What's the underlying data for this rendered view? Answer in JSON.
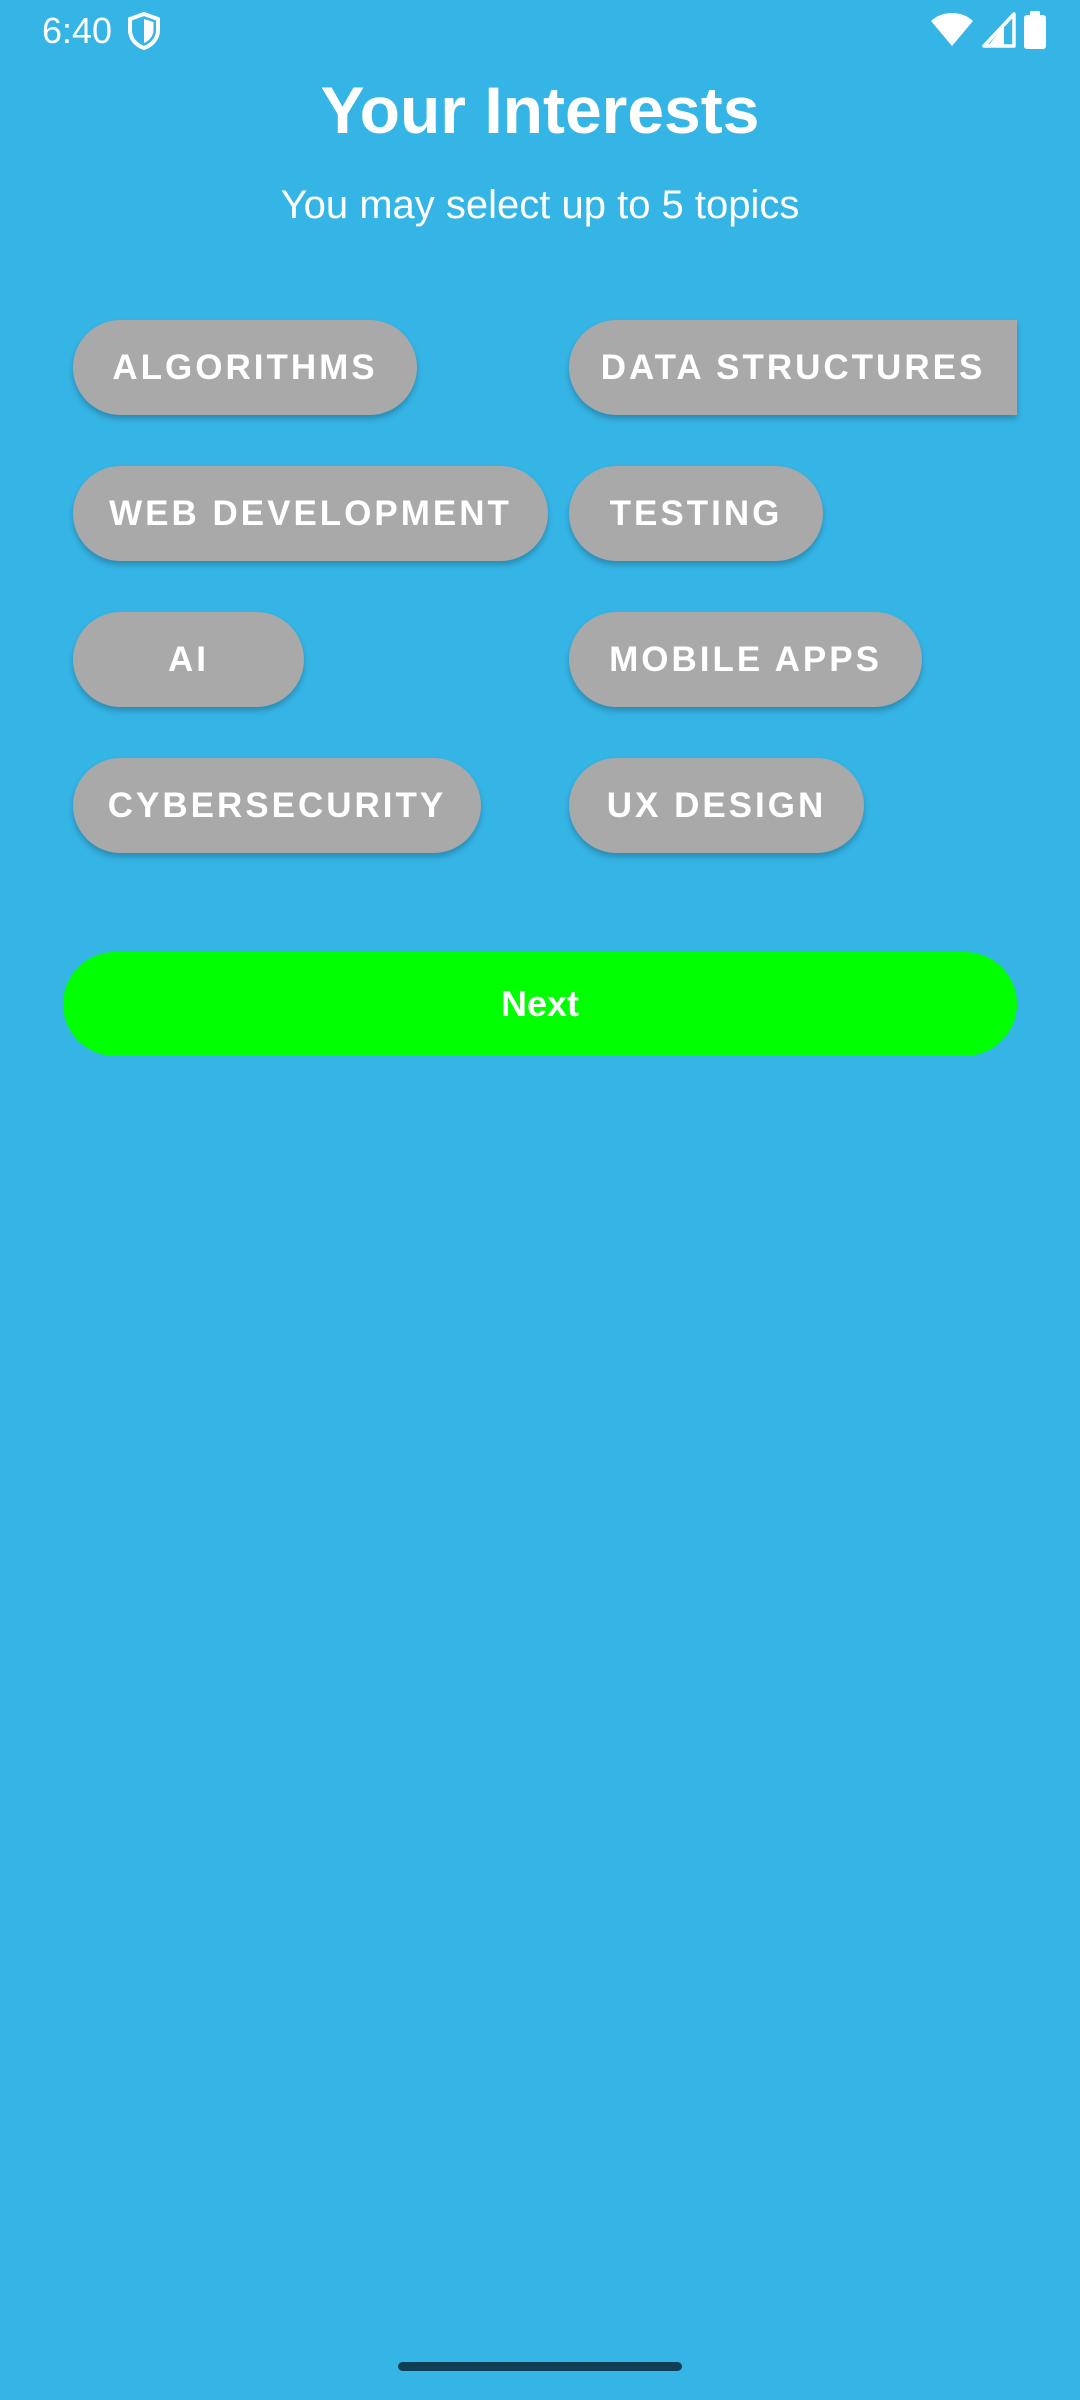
{
  "status_bar": {
    "time": "6:40",
    "icons": [
      "shield-icon",
      "wifi-icon",
      "signal-icon",
      "battery-icon"
    ]
  },
  "header": {
    "title": "Your Interests",
    "subtitle": "You may select up to 5 topics"
  },
  "topics": [
    {
      "label": "ALGORITHMS"
    },
    {
      "label": "DATA STRUCTURES"
    },
    {
      "label": "WEB DEVELOPMENT"
    },
    {
      "label": "TESTING"
    },
    {
      "label": "AI"
    },
    {
      "label": "MOBILE APPS"
    },
    {
      "label": "CYBERSECURITY"
    },
    {
      "label": "UX DESIGN"
    }
  ],
  "next_button": {
    "label": "Next"
  },
  "colors": {
    "background": "#35b4e6",
    "chip": "#a9a9a9",
    "next_button": "#00ff00",
    "text": "#ffffff"
  }
}
